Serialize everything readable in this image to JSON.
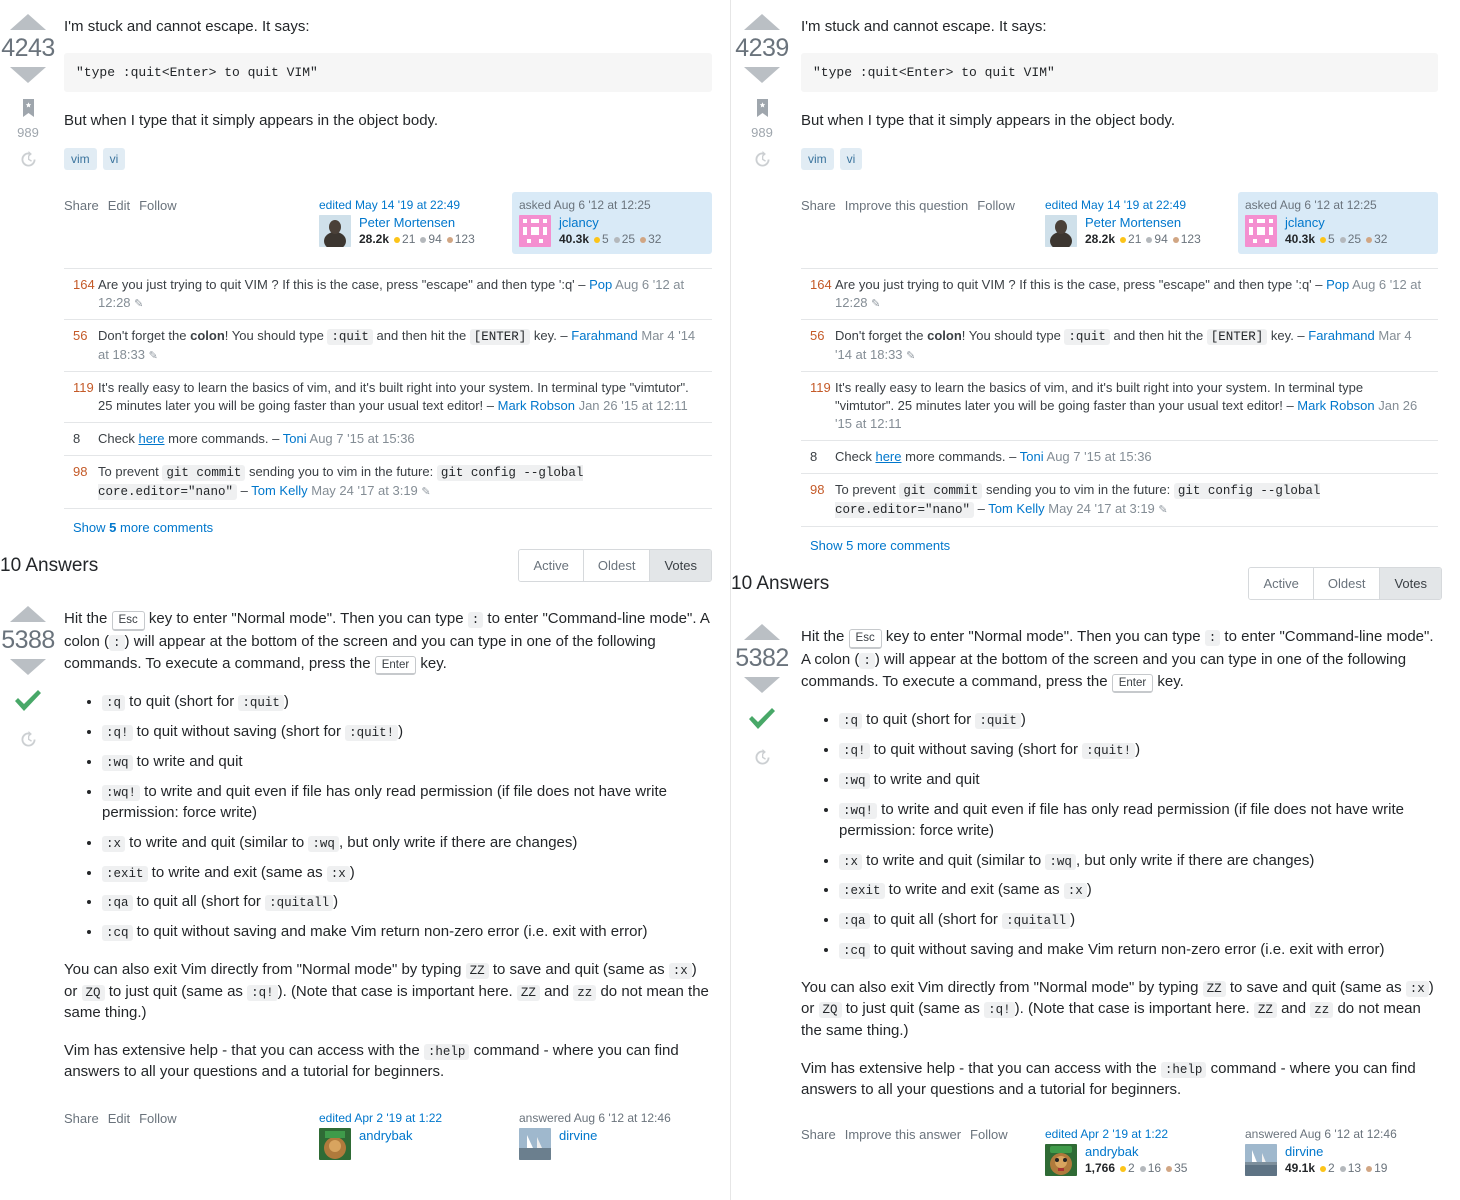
{
  "question": {
    "votes_left": "4243",
    "votes_right": "4239",
    "bookmark_count": "989",
    "intro": "I'm stuck and cannot escape. It says:",
    "code_block": "\"type :quit<Enter> to quit VIM\"",
    "followup": "But when I type that it simply appears in the object body.",
    "tags": [
      "vim",
      "vi"
    ],
    "actions_left": [
      "Share",
      "Edit",
      "Follow"
    ],
    "actions_right": [
      "Share",
      "Improve this question",
      "Follow"
    ],
    "edited": {
      "label": "edited May 14 '19 at 22:49",
      "user": "Peter Mortensen",
      "rep": "28.2k",
      "gold": "21",
      "silver": "94",
      "bronze": "123"
    },
    "asked": {
      "label": "asked Aug 6 '12 at 12:25",
      "user": "jclancy",
      "rep": "40.3k",
      "gold": "5",
      "silver": "25",
      "bronze": "32"
    }
  },
  "comments": [
    {
      "score": "164",
      "text_a": "Are you just trying to quit VIM ? If this is the case, press \"escape\" and then type ':q' – ",
      "user": "Pop",
      "date": "Aug 6 '12 at 12:28",
      "pencil": true
    },
    {
      "score": "56",
      "prefix": "Don't forget the ",
      "bold": "colon",
      "mid1": "! You should type ",
      "code1": ":quit",
      "mid2": " and then hit the ",
      "code2": "[ENTER]",
      "mid3": " key. – ",
      "user": "Farahmand",
      "date": "Mar 4 '14 at 18:33",
      "pencil": true
    },
    {
      "score": "119",
      "text_a": "It's really easy to learn the basics of vim, and it's built right into your system. In terminal type \"vimtutor\". 25 minutes later you will be going faster than your usual text editor! – ",
      "user": "Mark Robson",
      "date": "Jan 26 '15 at 12:11",
      "pencil": false
    },
    {
      "score": "8",
      "pre_link": "Check ",
      "link": "here",
      "post_link": " more commands. – ",
      "user": "Toni",
      "date": "Aug 7 '15 at 15:36",
      "pencil": false
    },
    {
      "score": "98",
      "prefix": "To prevent ",
      "code1": "git commit",
      "mid1": " sending you to vim in the future: ",
      "code2": "git config --global core.editor=\"nano\"",
      "mid2": " – ",
      "user": "Tom Kelly",
      "date": "May 24 '17 at 3:19",
      "pencil": true
    }
  ],
  "show_more": {
    "pre": "Show ",
    "count": "5",
    "post": " more comments"
  },
  "answers_header": {
    "title": "10 Answers",
    "tabs": [
      "Active",
      "Oldest",
      "Votes"
    ],
    "active_tab": "Votes"
  },
  "answer": {
    "votes_left": "5388",
    "votes_right": "5382",
    "accepted": true,
    "intro": {
      "p1": "Hit the ",
      "kbd1": "Esc",
      "p2": " key to enter \"Normal mode\". Then you can type ",
      "code1": ":",
      "p3": " to enter \"Command-line mode\". A colon (",
      "code2": ":",
      "p4": ") will appear at the bottom of the screen and you can type in one of the following commands. To execute a command, press the ",
      "kbd2": "Enter",
      "p5": " key."
    },
    "commands": [
      {
        "cmd": ":q",
        "text": " to quit (short for ",
        "code": ":quit",
        "tail": ")"
      },
      {
        "cmd": ":q!",
        "text": " to quit without saving (short for ",
        "code": ":quit!",
        "tail": ")"
      },
      {
        "cmd": ":wq",
        "text": " to write and quit",
        "code": "",
        "tail": ""
      },
      {
        "cmd": ":wq!",
        "text": " to write and quit even if file has only read permission (if file does not have write permission: force write)",
        "code": "",
        "tail": ""
      },
      {
        "cmd": ":x",
        "text": " to write and quit (similar to ",
        "code": ":wq",
        "tail": ", but only write if there are changes)"
      },
      {
        "cmd": ":exit",
        "text": " to write and exit (same as ",
        "code": ":x",
        "tail": ")"
      },
      {
        "cmd": ":qa",
        "text": " to quit all (short for ",
        "code": ":quitall",
        "tail": ")"
      },
      {
        "cmd": ":cq",
        "text": " to quit without saving and make Vim return non-zero error (i.e. exit with error)",
        "code": "",
        "tail": ""
      }
    ],
    "para2": {
      "a": "You can also exit Vim directly from \"Normal mode\" by typing ",
      "zz1": "ZZ",
      "b": " to save and quit (same as ",
      "x": ":x",
      "c": ") or ",
      "zq": "ZQ",
      "d": " to just quit (same as ",
      "q": ":q!",
      "e": "). (Note that case is important here. ",
      "zz2": "ZZ",
      "f": " and ",
      "zz3": "zz",
      "g": " do not mean the same thing.)"
    },
    "para3": {
      "a": "Vim has extensive help - that you can access with the ",
      "code": ":help",
      "b": " command - where you can find answers to all your questions and a tutorial for beginners."
    },
    "actions_left": [
      "Share",
      "Edit",
      "Follow"
    ],
    "actions_right": [
      "Share",
      "Improve this answer",
      "Follow"
    ],
    "edited": {
      "label": "edited Apr 2 '19 at 1:22",
      "user": "andrybak",
      "rep": "1,766",
      "gold": "2",
      "silver": "16",
      "bronze": "35"
    },
    "answered": {
      "label": "answered Aug 6 '12 at 12:46",
      "user": "dirvine",
      "rep": "49.1k",
      "gold": "2",
      "silver": "13",
      "bronze": "19"
    }
  },
  "colors": {
    "link": "#0077cc",
    "tag_bg": "#e1ecf4",
    "tag_fg": "#39739d",
    "score": "#c45a28",
    "accepted_green": "#48a868",
    "owner_card_bg": "#d9eaf7"
  }
}
